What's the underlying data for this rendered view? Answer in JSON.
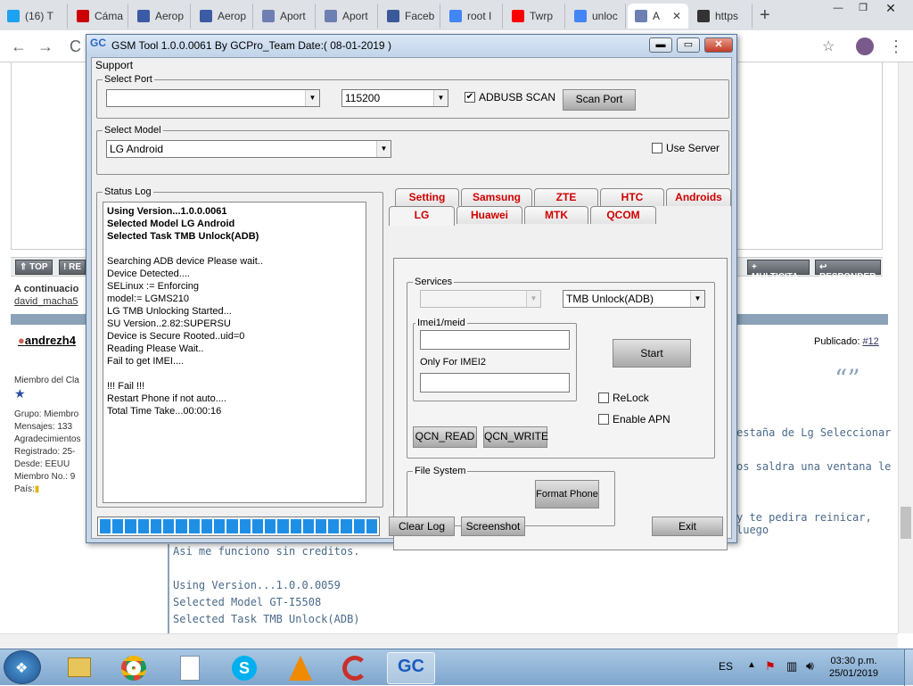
{
  "browser": {
    "tabs": [
      {
        "label": "(16) T",
        "icon": "twitter-icon",
        "color": "#1da1f2"
      },
      {
        "label": "Cáma",
        "icon": "record-icon",
        "color": "#cc0000"
      },
      {
        "label": "Aerop",
        "icon": "aerop-icon",
        "color": "#3b5ba5"
      },
      {
        "label": "Aerop",
        "icon": "aerop-icon",
        "color": "#3b5ba5"
      },
      {
        "label": "Aport",
        "icon": "aport-icon",
        "color": "#6d7fb3"
      },
      {
        "label": "Aport",
        "icon": "aport-icon",
        "color": "#6d7fb3"
      },
      {
        "label": "Faceb",
        "icon": "facebook-icon",
        "color": "#3b5998"
      },
      {
        "label": "root I",
        "icon": "google-icon",
        "color": "#4285f4"
      },
      {
        "label": "Twrp",
        "icon": "youtube-icon",
        "color": "#ff0000"
      },
      {
        "label": "unloc",
        "icon": "google-icon",
        "color": "#4285f4"
      },
      {
        "label": "A",
        "icon": "aport-icon",
        "color": "#6d7fb3"
      },
      {
        "label": "https",
        "icon": "spiral-icon",
        "color": "#333333"
      }
    ]
  },
  "forum": {
    "buttons": [
      "TOP",
      "RE",
      "MULTICITA",
      "RESPONDER"
    ],
    "continuation": "A continuacio",
    "link_user": "david_macha5",
    "username": "andrezh4",
    "published": "Publicado:",
    "post_num": "#12",
    "member_lines": [
      "Miembro del Cla",
      "Grupo: Miembro",
      "Mensajes: 133",
      "Agradecimientos",
      "Registrado: 25-",
      "Desde: EEUU",
      "Miembro No.: 9",
      "País:"
    ],
    "post_right": [
      "estaña de Lg Seleccionar",
      "os saldra una ventana le",
      "y te pedira reinicar, luego"
    ],
    "post_bottom": [
      "Asi me funciono sin creditos.",
      "Using Version...1.0.0.0059",
      "Selected Model GT-I5508",
      "Selected Task TMB Unlock(ADB)"
    ]
  },
  "app": {
    "title": "GSM Tool 1.0.0.0061 By GCPro_Team  Date:( 08-01-2019 )",
    "logo": "GC",
    "menu": "Support",
    "select_port": {
      "legend": "Select Port",
      "port_value": "",
      "baud_value": "115200",
      "adbusb_label": "ADBUSB SCAN",
      "adbusb_checked": true,
      "scan_label": "Scan Port"
    },
    "select_model": {
      "legend": "Select Model",
      "value": "LG Android",
      "use_server_label": "Use Server",
      "use_server_checked": false
    },
    "status_log": {
      "legend": "Status Log",
      "bold_lines": [
        "Using Version...1.0.0.0061",
        "Selected Model LG Android",
        "Selected Task TMB Unlock(ADB)"
      ],
      "lines": [
        "Searching ADB device Please wait..",
        "Device Detected....",
        "SELinux := Enforcing",
        "model:= LGMS210",
        "LG TMB Unlocking Started...",
        "SU Version..2.82:SUPERSU",
        "Device is Secure Rooted..uid=0",
        "Reading Please Wait..",
        "Fail to get IMEI...."
      ],
      "fail_lines": [
        "!!! Fail !!!",
        "Restart Phone if not auto....",
        "Total Time Take...00:00:16"
      ]
    },
    "tabs_row1": [
      "Setting",
      "Samsung",
      "ZTE",
      "HTC",
      "Androids"
    ],
    "tabs_row2": [
      "LG",
      "Huawei",
      "MTK",
      "QCOM"
    ],
    "services": {
      "legend": "Services",
      "combo1": "",
      "combo2": "TMB Unlock(ADB)",
      "imei_legend": "Imei1/meid",
      "imei2_label": "Only For IMEI2",
      "start": "Start",
      "relock": "ReLock",
      "enable_apn": "Enable APN",
      "qcn_read": "QCN_READ",
      "qcn_write": "QCN_WRITE"
    },
    "file_system": {
      "legend": "File System",
      "format": "Format Phone"
    },
    "footer": {
      "clear_log": "Clear Log",
      "screenshot": "Screenshot",
      "exit": "Exit"
    },
    "progress": 1.0
  },
  "taskbar": {
    "lang": "ES",
    "time": "03:30 p.m.",
    "date": "25/01/2019"
  }
}
